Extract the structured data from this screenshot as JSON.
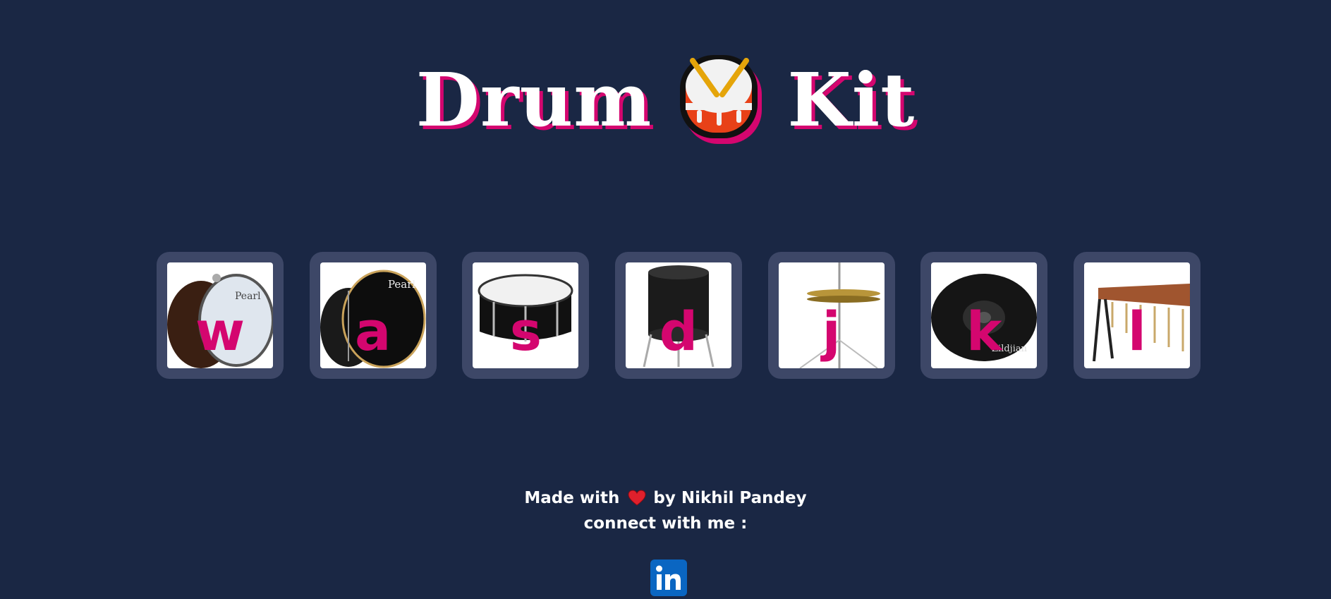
{
  "header": {
    "word1": "Drum",
    "word2": "Kit",
    "icon": "drum-icon"
  },
  "drums": [
    {
      "key": "w",
      "instrument": "bass-drum-white-head"
    },
    {
      "key": "a",
      "instrument": "bass-drum-black"
    },
    {
      "key": "s",
      "instrument": "snare-drum"
    },
    {
      "key": "d",
      "instrument": "floor-tom"
    },
    {
      "key": "j",
      "instrument": "hi-hat"
    },
    {
      "key": "k",
      "instrument": "crash-cymbal"
    },
    {
      "key": "l",
      "instrument": "marimba"
    }
  ],
  "footer": {
    "made_with": "Made with",
    "by": "by Nikhil Pandey",
    "connect": "connect with me :",
    "heart_icon": "heart-icon",
    "social_icon": "linkedin-icon"
  },
  "colors": {
    "background": "#1a2744",
    "accent": "#d4066f",
    "card": "#3d4767",
    "linkedin": "#0a66c2"
  }
}
